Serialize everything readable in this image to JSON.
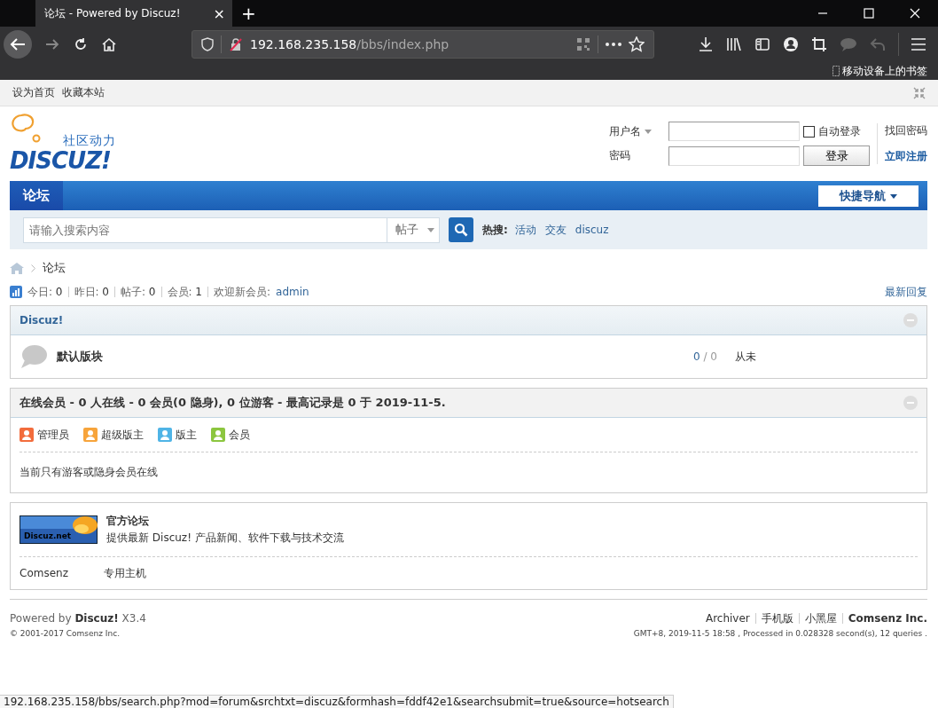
{
  "browser": {
    "tab_title": "论坛 - Powered by Discuz!",
    "tab_close": "×",
    "new_tab": "+",
    "url_host": "192.168.235.158",
    "url_path": "/bbs/index.php",
    "bookmarks_label": "移动设备上的书签"
  },
  "topbar": {
    "links": [
      "设为首页",
      "收藏本站"
    ]
  },
  "logo": {
    "tagline": "社区动力",
    "wordmark": "DISCUZ!"
  },
  "login": {
    "username_label": "用户名",
    "password_label": "密码",
    "auto_login": {
      "label": "自动登录",
      "checked": false
    },
    "login_button": "登录",
    "forgot": "找回密码",
    "register": "立即注册"
  },
  "nav": {
    "tabs": [
      {
        "label": "论坛",
        "selected": true
      }
    ],
    "quick_nav": "快捷导航"
  },
  "search": {
    "placeholder": "请输入搜索内容",
    "scope": "帖子",
    "hot_label": "热搜:",
    "hot": [
      "活动",
      "交友",
      "discuz"
    ]
  },
  "breadcrumb": [
    "论坛"
  ],
  "stats": [
    {
      "label": "今日:",
      "value": "0"
    },
    {
      "label": "昨日:",
      "value": "0"
    },
    {
      "label": "帖子:",
      "value": "0"
    },
    {
      "label": "会员:",
      "value": "1"
    }
  ],
  "welcome": {
    "label": "欢迎新会员:",
    "user": "admin"
  },
  "latest_replies": "最新回复",
  "category": {
    "title": "Discuz!",
    "forums": [
      {
        "name": "默认版块",
        "threads": "0",
        "separator": "/",
        "posts": "0",
        "last": "从未"
      }
    ]
  },
  "online": {
    "title": "在线会员 - 0 人在线 - 0 会员(0 隐身), 0 位游客 - 最高记录是 0 于 2019-11-5.",
    "legend": [
      {
        "label": "管理员",
        "color": "#f26c3c"
      },
      {
        "label": "超级版主",
        "color": "#f7a43b"
      },
      {
        "label": "版主",
        "color": "#4fb4e6"
      },
      {
        "label": "会员",
        "color": "#8cc63f"
      }
    ],
    "note": "当前只有游客或隐身会员在线"
  },
  "friend_links": {
    "featured": {
      "banner": "Discuz.net",
      "title": "官方论坛",
      "desc": "提供最新 Discuz! 产品新闻、软件下载与技术交流"
    },
    "text_links": [
      "Comsenz",
      "专用主机"
    ]
  },
  "footer": {
    "powered": "Powered by **Discuz!** X3.4",
    "copyright": "© 2001-2017 Comsenz Inc.",
    "links": [
      {
        "label": "Archiver",
        "bold": false
      },
      {
        "label": "手机版",
        "bold": false
      },
      {
        "label": "小黑屋",
        "bold": false
      },
      {
        "label": "Comsenz Inc.",
        "bold": true
      }
    ],
    "timing": "GMT+8, 2019-11-5 18:58 , Processed in 0.028328 second(s), 12 queries ."
  },
  "status_url": "192.168.235.158/bbs/search.php?mod=forum&srchtxt=discuz&formhash=fddf42e1&searchsubmit=true&source=hotsearch"
}
